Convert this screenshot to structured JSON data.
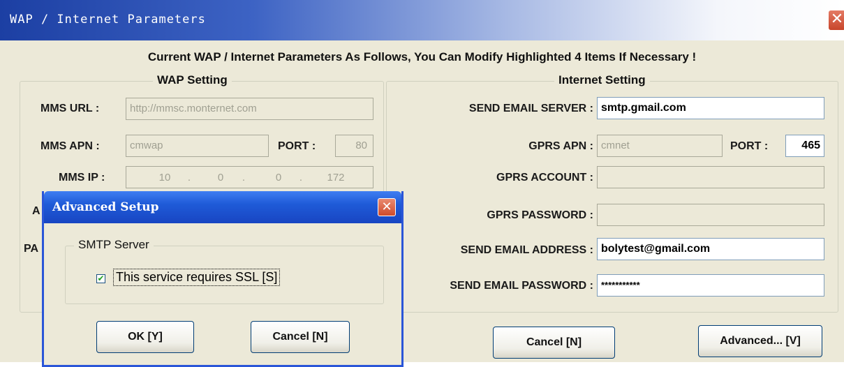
{
  "window": {
    "title": "WAP / Internet Parameters",
    "close_glyph": "✕"
  },
  "headline": "Current WAP / Internet Parameters As Follows, You Can Modify Highlighted 4 Items If Necessary !",
  "wap": {
    "title": "WAP Setting",
    "mms_url_label": "MMS URL :",
    "mms_url_value": "http://mmsc.monternet.com",
    "mms_apn_label": "MMS APN :",
    "mms_apn_value": "cmwap",
    "port_label": "PORT :",
    "port_value": "80",
    "mms_ip_label": "MMS IP :",
    "mms_ip": [
      "10",
      "0",
      "0",
      "172"
    ],
    "ip_dot": ".",
    "partial_label_a": "A",
    "partial_label_pa": "PA"
  },
  "internet": {
    "title": "Internet Setting",
    "send_email_server_label": "SEND EMAIL SERVER :",
    "send_email_server_value": "smtp.gmail.com",
    "gprs_apn_label": "GPRS APN :",
    "gprs_apn_value": "cmnet",
    "port_label": "PORT :",
    "port_value": "465",
    "gprs_account_label": "GPRS ACCOUNT :",
    "gprs_account_value": "",
    "gprs_password_label": "GPRS PASSWORD :",
    "gprs_password_value": "",
    "send_email_address_label": "SEND EMAIL ADDRESS :",
    "send_email_address_value": "bolytest@gmail.com",
    "send_email_password_label": "SEND EMAIL PASSWORD :",
    "send_email_password_value": "***********"
  },
  "buttons": {
    "cancel": "Cancel [N]",
    "advanced": "Advanced... [V]"
  },
  "dialog": {
    "title": "Advanced Setup",
    "close_glyph": "✕",
    "group_title": "SMTP Server",
    "ssl_checked": true,
    "check_glyph": "✔",
    "ssl_label": "This service requires SSL [S]",
    "ok": "OK [Y]",
    "cancel": "Cancel [N]"
  },
  "colors": {
    "title_bar": "#1c3fa3",
    "dialog_title": "#1f5bd8",
    "face": "#ece9d8"
  }
}
